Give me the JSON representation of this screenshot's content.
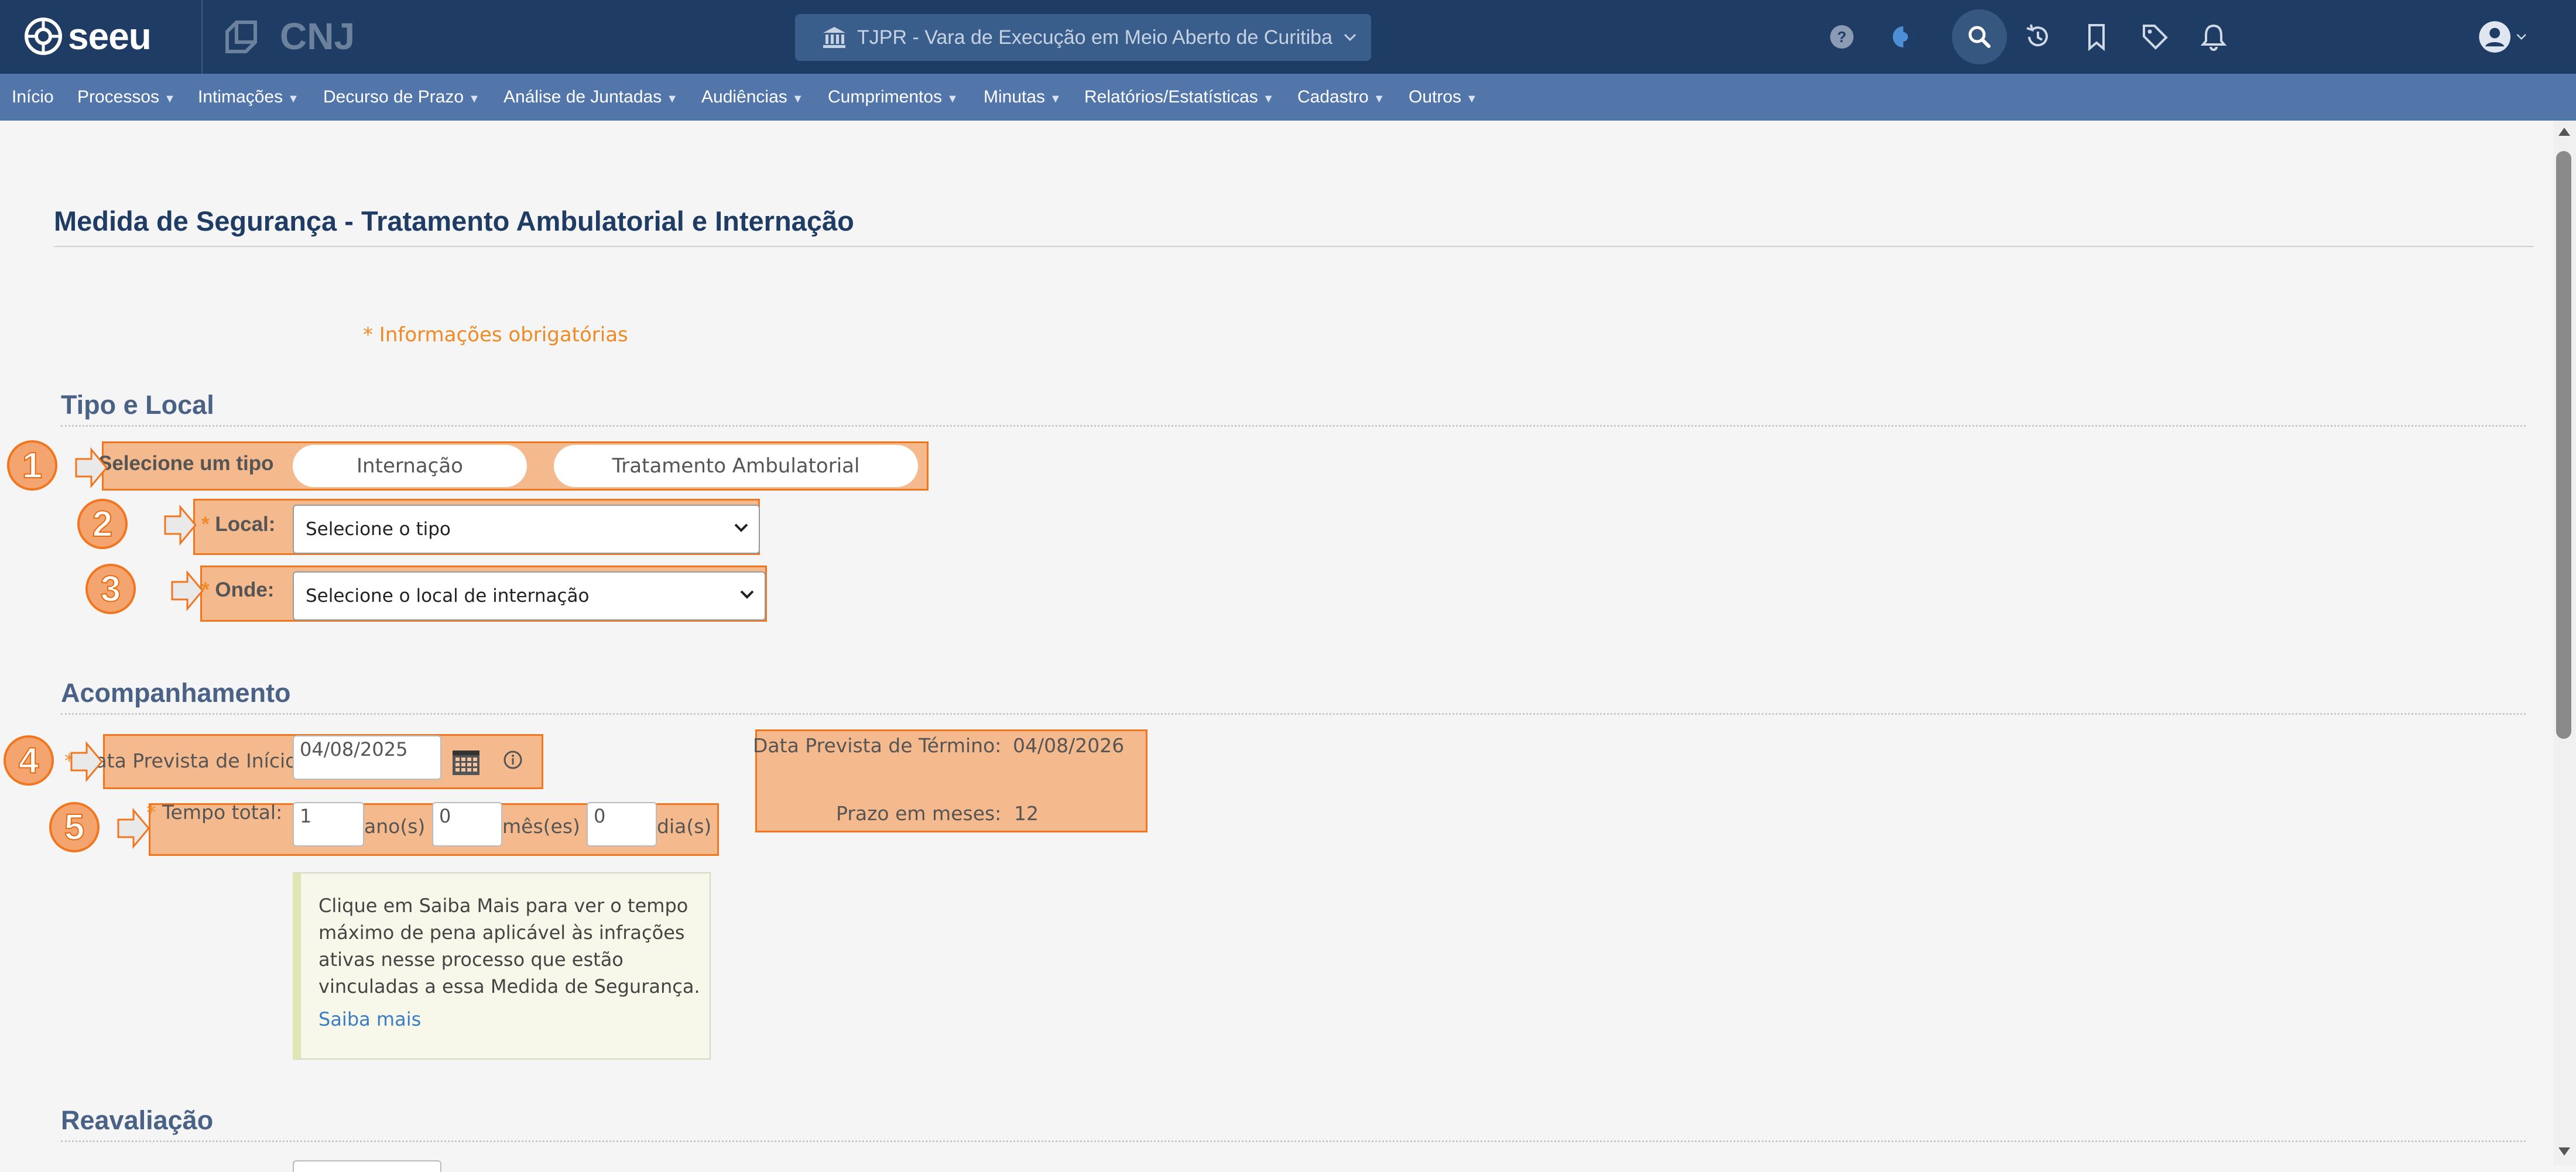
{
  "header": {
    "logo_text": "seeu",
    "cnj_text": "CNJ",
    "court_selector": "TJPR - Vara de Execução em Meio Aberto de Curitiba",
    "icons": [
      "help-icon",
      "theme-icon",
      "search-icon",
      "history-icon",
      "bookmark-icon",
      "tag-icon",
      "bell-icon",
      "user-icon"
    ]
  },
  "menu": {
    "items": [
      {
        "label": "Início"
      },
      {
        "label": "Processos"
      },
      {
        "label": "Intimações"
      },
      {
        "label": "Decurso de Prazo"
      },
      {
        "label": "Análise de Juntadas"
      },
      {
        "label": "Audiências"
      },
      {
        "label": "Cumprimentos"
      },
      {
        "label": "Minutas"
      },
      {
        "label": "Relatórios/Estatísticas"
      },
      {
        "label": "Cadastro"
      },
      {
        "label": "Outros"
      }
    ]
  },
  "page": {
    "title": "Medida de Segurança - Tratamento Ambulatorial e Internação",
    "required_note": "* Informações obrigatórias"
  },
  "tipo_local": {
    "heading": "Tipo e Local",
    "tipo_label": "Selecione um tipo",
    "tipo_options": [
      "Internação",
      "Tratamento Ambulatorial"
    ],
    "req_mark": "*",
    "local_label": "Local:",
    "local_value": "Selecione o tipo",
    "onde_label": "Onde:",
    "onde_value": "Selecione o local de internação"
  },
  "acompanhamento": {
    "heading": "Acompanhamento",
    "data_inicio_label": "Data Prevista de Início:",
    "data_inicio_value": "04/08/2025",
    "tempo_total_label": "Tempo total:",
    "anos_value": "1",
    "anos_unit": "ano(s)",
    "meses_value": "0",
    "meses_unit": "mês(es)",
    "dias_value": "0",
    "dias_unit": "dia(s)",
    "data_termino_label": "Data Prevista de Término:",
    "data_termino_value": "04/08/2026",
    "prazo_label": "Prazo em meses:",
    "prazo_value": "12",
    "info_lines": [
      "Clique em Saiba Mais para ver o tempo",
      "máximo de pena aplicável às infrações",
      "ativas nesse processo que estão",
      "vinculadas a essa Medida de Segurança."
    ],
    "info_link": "Saiba mais"
  },
  "reavaliacao": {
    "heading": "Reavaliação"
  },
  "annotations": {
    "badges": [
      "1",
      "2",
      "3",
      "4",
      "5"
    ],
    "overlay_color": "#f28637"
  }
}
